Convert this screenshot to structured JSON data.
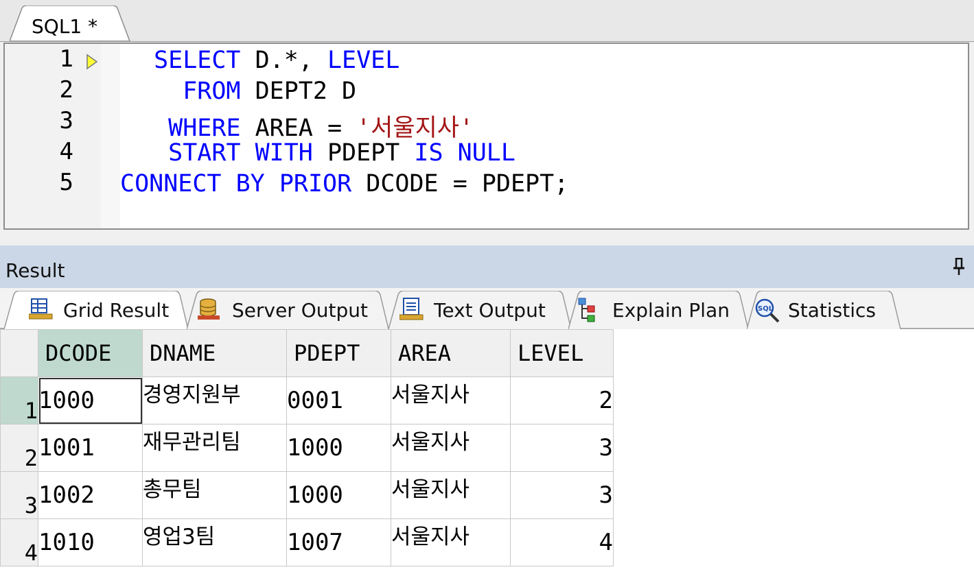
{
  "editor_tab": {
    "title": "SQL1 *"
  },
  "editor": {
    "line_numbers": [
      "1",
      "2",
      "3",
      "4",
      "5"
    ],
    "lines": [
      {
        "indent": " ",
        "tokens": [
          {
            "t": "SELECT",
            "kw": true
          },
          {
            "t": " D.*, "
          },
          {
            "t": "LEVEL",
            "kw": true
          }
        ]
      },
      {
        "indent": "   ",
        "tokens": [
          {
            "t": "FROM",
            "kw": true
          },
          {
            "t": " DEPT2 D"
          }
        ]
      },
      {
        "indent": "  ",
        "tokens": [
          {
            "t": "WHERE",
            "kw": true
          },
          {
            "t": " AREA = "
          },
          {
            "t": "'서울지사'",
            "str": true
          }
        ]
      },
      {
        "indent": "  ",
        "tokens": [
          {
            "t": "START",
            "kw": true
          },
          {
            "t": " "
          },
          {
            "t": "WITH",
            "kw": true
          },
          {
            "t": " PDEPT "
          },
          {
            "t": "IS",
            "kw": true
          },
          {
            "t": " "
          },
          {
            "t": "NULL",
            "kw": true
          }
        ]
      },
      {
        "indent": "",
        "tokens": [
          {
            "t": "CONNECT",
            "kw": true
          },
          {
            "t": " "
          },
          {
            "t": "BY",
            "kw": true
          },
          {
            "t": " "
          },
          {
            "t": "PRIOR",
            "kw": true
          },
          {
            "t": " DCODE = PDEPT;"
          }
        ]
      }
    ],
    "keyword_color": "#0000ff",
    "string_color": "#a31515"
  },
  "result_panel": {
    "title": "Result",
    "pin_icon": "pin-icon",
    "tabs": [
      {
        "label": "Grid Result",
        "icon": "grid-icon",
        "active": true
      },
      {
        "label": "Server Output",
        "icon": "database-icon",
        "active": false
      },
      {
        "label": "Text Output",
        "icon": "document-icon",
        "active": false
      },
      {
        "label": "Explain Plan",
        "icon": "plan-tree-icon",
        "active": false
      },
      {
        "label": "Statistics",
        "icon": "sql-magnifier-icon",
        "active": false
      }
    ]
  },
  "grid": {
    "columns": [
      "DCODE",
      "DNAME",
      "PDEPT",
      "AREA",
      "LEVEL"
    ],
    "rows": [
      {
        "n": "1",
        "cells": [
          "1000",
          "경영지원부",
          "0001",
          "서울지사",
          "2"
        ]
      },
      {
        "n": "2",
        "cells": [
          "1001",
          "재무관리팀",
          "1000",
          "서울지사",
          "3"
        ]
      },
      {
        "n": "3",
        "cells": [
          "1002",
          "총무팀",
          "1000",
          "서울지사",
          "3"
        ]
      },
      {
        "n": "4",
        "cells": [
          "1010",
          "영업3팀",
          "1007",
          "서울지사",
          "4"
        ]
      }
    ],
    "selected_color": "#bfd9cf"
  }
}
